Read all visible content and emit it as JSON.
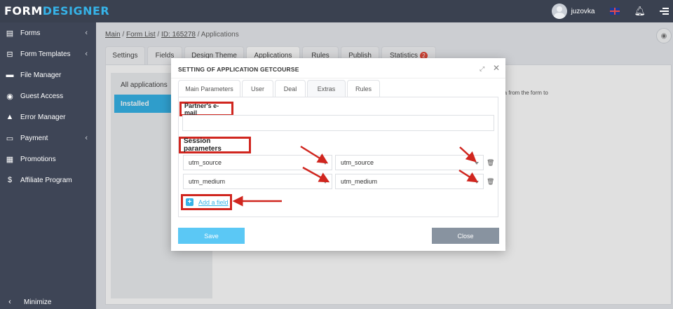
{
  "app": {
    "logo_part1": "FORM",
    "logo_part2": "DESIGNER",
    "username": "juzovka",
    "accent_color": "#36b3e8",
    "annotation_color": "#d0261f"
  },
  "sidebar": {
    "items": [
      {
        "label": "Forms",
        "icon": "forms-icon",
        "has_chevron": true
      },
      {
        "label": "Form Templates",
        "icon": "template-icon",
        "has_chevron": true
      },
      {
        "label": "File Manager",
        "icon": "folder-icon",
        "has_chevron": false
      },
      {
        "label": "Guest Access",
        "icon": "user-icon",
        "has_chevron": false
      },
      {
        "label": "Error Manager",
        "icon": "warning-icon",
        "has_chevron": false
      },
      {
        "label": "Payment",
        "icon": "card-icon",
        "has_chevron": true
      },
      {
        "label": "Promotions",
        "icon": "gift-icon",
        "has_chevron": false
      },
      {
        "label": "Affiliate Program",
        "icon": "dollar-icon",
        "has_chevron": false
      }
    ],
    "minimize_label": "Minimize"
  },
  "breadcrumb": {
    "main": "Main",
    "form_list": "Form List",
    "id": "ID: 165278",
    "current": "Applications",
    "sep": " / "
  },
  "main_tabs": [
    {
      "label": "Settings"
    },
    {
      "label": "Fields"
    },
    {
      "label": "Design Theme"
    },
    {
      "label": "Applications"
    },
    {
      "label": "Rules"
    },
    {
      "label": "Publish"
    },
    {
      "label": "Statistics",
      "badge": "2"
    }
  ],
  "applications": {
    "items": [
      "All applications",
      "Installed"
    ],
    "background_text": "ata from the form to"
  },
  "modal": {
    "title": "SETTING OF APPLICATION GETCOURSE",
    "tabs": [
      "Main Parameters",
      "User",
      "Deal",
      "Extras",
      "Rules"
    ],
    "active_tab": "Extras",
    "partner_email_label": "Partner's e-mail",
    "partner_email_value": "",
    "session_label": "Session parameters",
    "session_rows": [
      {
        "left": "utm_source",
        "right": "utm_source"
      },
      {
        "left": "utm_medium",
        "right": "utm_medium"
      }
    ],
    "add_field_label": "Add a field",
    "save_label": "Save",
    "close_label": "Close"
  }
}
